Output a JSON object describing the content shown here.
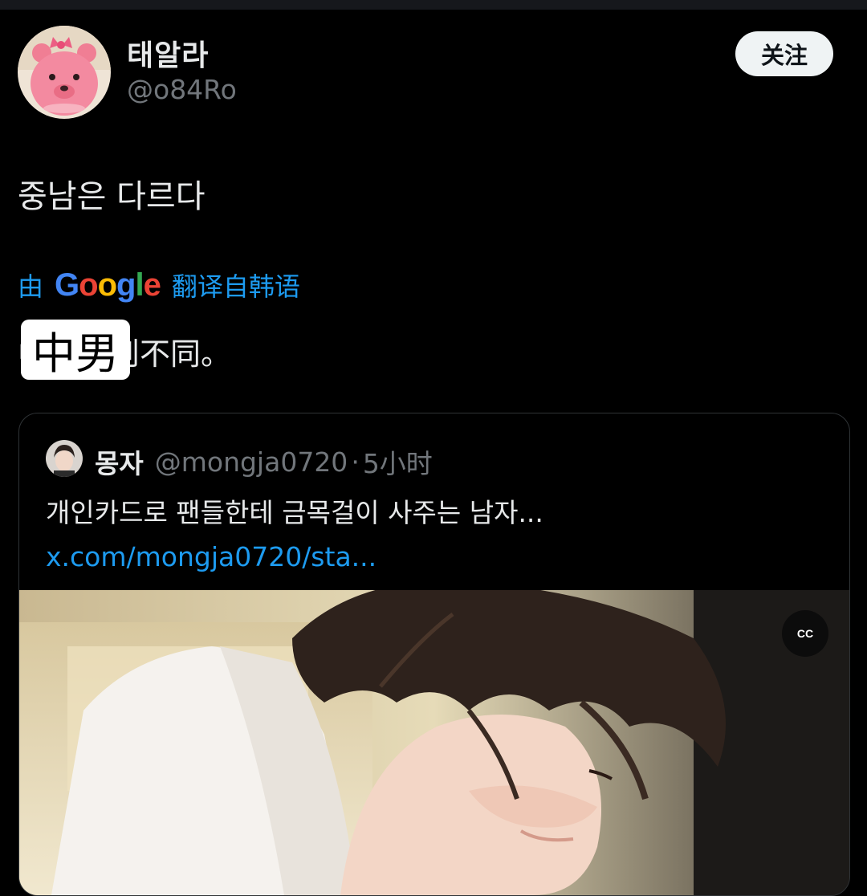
{
  "user": {
    "display_name": "태알라",
    "handle": "@o84Ro",
    "avatar": "pink-bear-avatar-icon"
  },
  "follow_label": "关注",
  "tweet_text": "중남은 다르다",
  "translation": {
    "prefix": "由",
    "google": [
      "G",
      "o",
      "o",
      "g",
      "l",
      "e"
    ],
    "suffix": "翻译自韩语",
    "text": "中男人则不同。",
    "overlay_label": "中男"
  },
  "quote": {
    "name": "몽자",
    "handle": "@mongja0720",
    "separator": "·",
    "time": "5小时",
    "text": "개인카드로 팬들한테 금목걸이 사주는 남자...",
    "link": "x.com/mongja0720/sta...",
    "cc_label": "CC"
  },
  "colors": {
    "accent": "#1d9bf0",
    "text": "#e7e9ea",
    "muted": "#71767b",
    "background": "#000000",
    "google_blue": "#4285f4",
    "google_red": "#ea4335",
    "google_yellow": "#fbbc05",
    "google_green": "#34a853"
  }
}
